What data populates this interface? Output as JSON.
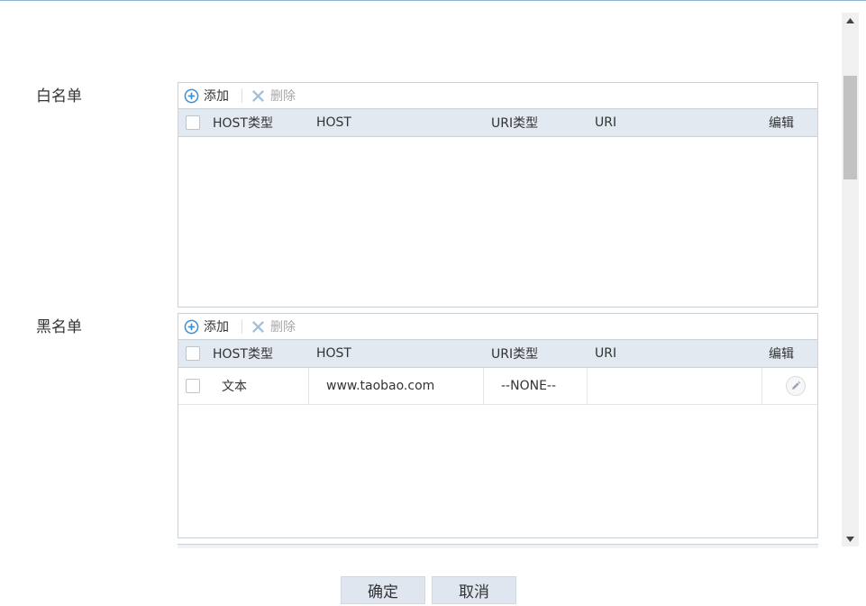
{
  "toolbar": {
    "add_label": "添加",
    "delete_label": "删除"
  },
  "columns": [
    "HOST类型",
    "HOST",
    "URI类型",
    "URI",
    "编辑"
  ],
  "whitelist": {
    "label": "白名单",
    "rows": []
  },
  "blacklist": {
    "label": "黑名单",
    "rows": [
      {
        "host_type": "文本",
        "host": "www.taobao.com",
        "uri_type": "--NONE--",
        "uri": ""
      }
    ]
  },
  "buttons": {
    "confirm": "确定",
    "cancel": "取消"
  },
  "colors": {
    "accent": "#3b8ed6",
    "header_bg": "#e2e9f0",
    "button_bg": "#dfe6ef"
  }
}
